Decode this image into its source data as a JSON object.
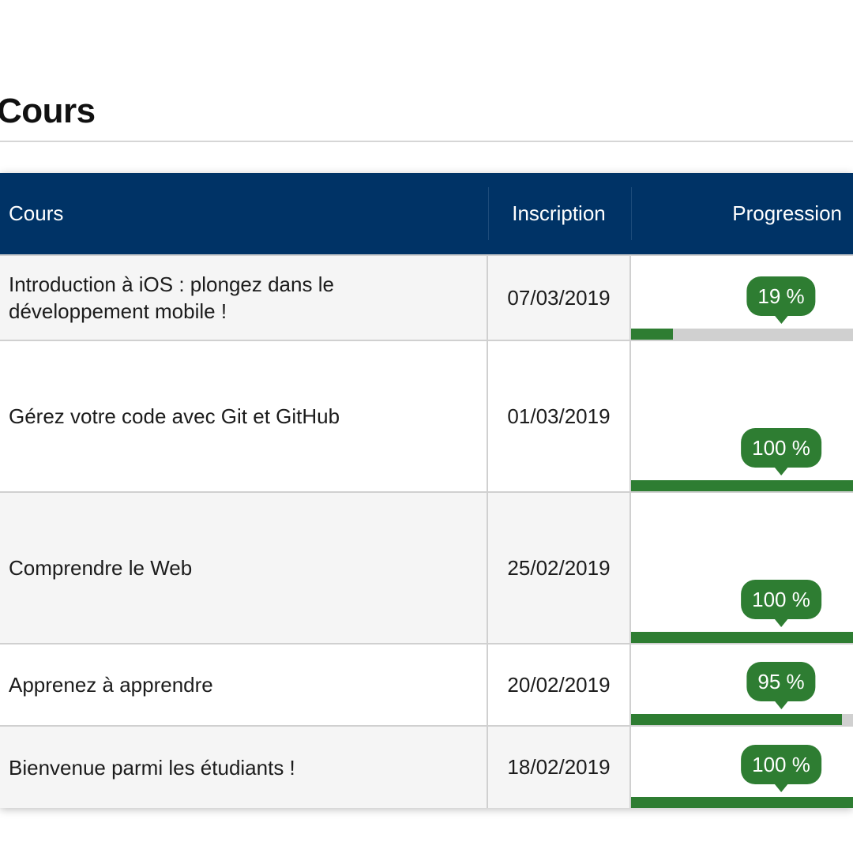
{
  "page": {
    "title": "Cours"
  },
  "table": {
    "headers": {
      "course": "Cours",
      "date": "Inscription",
      "progress": "Progression"
    },
    "rows": [
      {
        "course": "Introduction à iOS : plongez dans le développement mobile !",
        "date": "07/03/2019",
        "progress_label": "19 %",
        "progress": 0.19
      },
      {
        "course": "Gérez votre code avec Git et GitHub",
        "date": "01/03/2019",
        "progress_label": "100 %",
        "progress": 1.0
      },
      {
        "course": "Comprendre le Web",
        "date": "25/02/2019",
        "progress_label": "100 %",
        "progress": 1.0
      },
      {
        "course": "Apprenez à apprendre",
        "date": "20/02/2019",
        "progress_label": "95 %",
        "progress": 0.95
      },
      {
        "course": "Bienvenue parmi les étudiants !",
        "date": "18/02/2019",
        "progress_label": "100 %",
        "progress": 1.0
      }
    ]
  },
  "colors": {
    "header_bg": "#003366",
    "progress_green": "#2e7d32",
    "track_gray": "#d0d0d0"
  }
}
